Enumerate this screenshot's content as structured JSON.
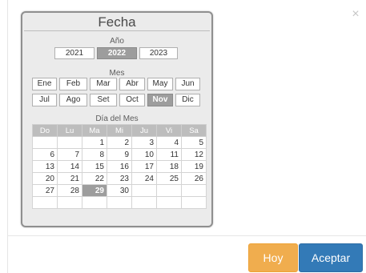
{
  "close_icon": "×",
  "buttons": {
    "today": "Hoy",
    "accept": "Aceptar"
  },
  "picker": {
    "title": "Fecha",
    "year_label": "Año",
    "years": [
      "2021",
      "2022",
      "2023"
    ],
    "selected_year": "2022",
    "month_label": "Mes",
    "months": [
      "Ene",
      "Feb",
      "Mar",
      "Abr",
      "May",
      "Jun",
      "Jul",
      "Ago",
      "Set",
      "Oct",
      "Nov",
      "Dic"
    ],
    "selected_month": "Nov",
    "day_label": "Día del Mes",
    "weekdays": [
      "Do",
      "Lu",
      "Ma",
      "Mi",
      "Ju",
      "Vi",
      "Sa"
    ],
    "weeks": [
      [
        "",
        "",
        "1",
        "2",
        "3",
        "4",
        "5"
      ],
      [
        "6",
        "7",
        "8",
        "9",
        "10",
        "11",
        "12"
      ],
      [
        "13",
        "14",
        "15",
        "16",
        "17",
        "18",
        "19"
      ],
      [
        "20",
        "21",
        "22",
        "23",
        "24",
        "25",
        "26"
      ],
      [
        "27",
        "28",
        "29",
        "30",
        "",
        "",
        ""
      ],
      [
        "",
        "",
        "",
        "",
        "",
        "",
        ""
      ]
    ],
    "selected_day": "29"
  },
  "colors": {
    "today_button": "#f0ad4e",
    "accept_button": "#337ab7",
    "selected": "#9d9d9d",
    "weekday_header": "#bdbdbd",
    "picker_background": "#ebebeb"
  }
}
